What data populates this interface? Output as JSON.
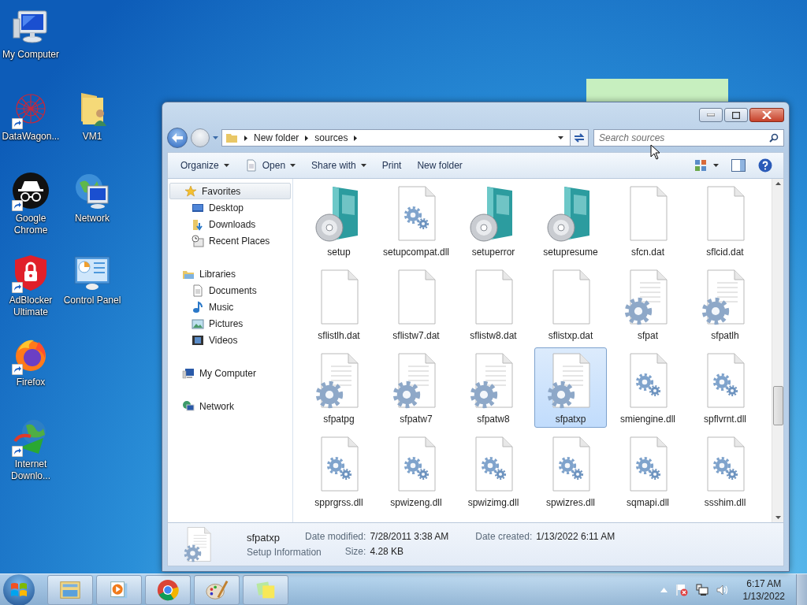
{
  "desktop": {
    "icons": [
      {
        "label": "My Computer",
        "kind": "computer",
        "shortcut": false
      },
      {
        "label": "DataWagon...",
        "kind": "graph",
        "shortcut": true
      },
      {
        "label": "VM1",
        "kind": "user-folder",
        "shortcut": false
      },
      {
        "label": "Google Chrome",
        "kind": "incognito",
        "shortcut": true
      },
      {
        "label": "Network",
        "kind": "network",
        "shortcut": false
      },
      {
        "label": "AdBlocker Ultimate",
        "kind": "shield",
        "shortcut": true
      },
      {
        "label": "Control Panel",
        "kind": "control-panel",
        "shortcut": false
      },
      {
        "label": "Firefox",
        "kind": "firefox",
        "shortcut": true
      },
      {
        "label": "Internet Downlo...",
        "kind": "downloader",
        "shortcut": true
      }
    ]
  },
  "explorer": {
    "breadcrumbs": [
      "New folder",
      "sources"
    ],
    "search": {
      "placeholder": "Search sources"
    },
    "toolbar": [
      {
        "label": "Organize",
        "kind": "plain",
        "dropdown": true
      },
      {
        "label": "Open",
        "kind": "icon",
        "dropdown": true
      },
      {
        "label": "Share with",
        "kind": "plain",
        "dropdown": true
      },
      {
        "label": "Print",
        "kind": "plain",
        "dropdown": false
      },
      {
        "label": "New folder",
        "kind": "plain",
        "dropdown": false
      }
    ],
    "navigation": [
      {
        "label": "Favorites",
        "kind": "favorites",
        "selected": true,
        "children": [
          {
            "label": "Desktop",
            "kind": "desktop",
            "selected": false
          },
          {
            "label": "Downloads",
            "kind": "downloads",
            "selected": false
          },
          {
            "label": "Recent Places",
            "kind": "recent",
            "selected": false
          }
        ]
      },
      {
        "label": "Libraries",
        "kind": "libraries",
        "selected": false,
        "children": [
          {
            "label": "Documents",
            "kind": "documents",
            "selected": false
          },
          {
            "label": "Music",
            "kind": "music",
            "selected": false
          },
          {
            "label": "Pictures",
            "kind": "pictures",
            "selected": false
          },
          {
            "label": "Videos",
            "kind": "videos",
            "selected": false
          }
        ]
      },
      {
        "label": "My Computer",
        "kind": "computer",
        "selected": false
      },
      {
        "label": "Network",
        "kind": "network",
        "selected": false
      }
    ],
    "files": [
      {
        "name": "setup",
        "kind": "installer",
        "selected": false
      },
      {
        "name": "setupcompat.dll",
        "kind": "dll",
        "selected": false
      },
      {
        "name": "setuperror",
        "kind": "installer",
        "selected": false
      },
      {
        "name": "setupresume",
        "kind": "installer",
        "selected": false
      },
      {
        "name": "sfcn.dat",
        "kind": "blank",
        "selected": false
      },
      {
        "name": "sflcid.dat",
        "kind": "blank",
        "selected": false
      },
      {
        "name": "sflistlh.dat",
        "kind": "blank",
        "selected": false
      },
      {
        "name": "sflistw7.dat",
        "kind": "blank",
        "selected": false
      },
      {
        "name": "sflistw8.dat",
        "kind": "blank",
        "selected": false
      },
      {
        "name": "sflistxp.dat",
        "kind": "blank",
        "selected": false
      },
      {
        "name": "sfpat",
        "kind": "inf",
        "selected": false
      },
      {
        "name": "sfpatlh",
        "kind": "inf",
        "selected": false
      },
      {
        "name": "sfpatpg",
        "kind": "inf",
        "selected": false
      },
      {
        "name": "sfpatw7",
        "kind": "inf",
        "selected": false
      },
      {
        "name": "sfpatw8",
        "kind": "inf",
        "selected": false
      },
      {
        "name": "sfpatxp",
        "kind": "inf",
        "selected": true
      },
      {
        "name": "smiengine.dll",
        "kind": "dll",
        "selected": false
      },
      {
        "name": "spflvrnt.dll",
        "kind": "dll",
        "selected": false
      },
      {
        "name": "spprgrss.dll",
        "kind": "dll",
        "selected": false
      },
      {
        "name": "spwizeng.dll",
        "kind": "dll",
        "selected": false
      },
      {
        "name": "spwizimg.dll",
        "kind": "dll",
        "selected": false
      },
      {
        "name": "spwizres.dll",
        "kind": "dll",
        "selected": false
      },
      {
        "name": "sqmapi.dll",
        "kind": "dll",
        "selected": false
      },
      {
        "name": "ssshim.dll",
        "kind": "dll",
        "selected": false
      }
    ],
    "details": {
      "name": "sfpatxp",
      "type": "Setup Information",
      "kind": "inf",
      "columns": [
        [
          {
            "label": "Date modified:",
            "value": "7/28/2011 3:38 AM"
          },
          {
            "label": "Size:",
            "value": "4.28 KB"
          }
        ],
        [
          {
            "label": "Date created:",
            "value": "1/13/2022 6:11 AM"
          }
        ]
      ]
    }
  },
  "taskbar": {
    "apps": [
      {
        "kind": "explorer"
      },
      {
        "kind": "media"
      },
      {
        "kind": "chrome"
      },
      {
        "kind": "paint"
      },
      {
        "kind": "notes"
      }
    ],
    "clock": {
      "time": "6:17 AM",
      "date": "1/13/2022"
    }
  }
}
